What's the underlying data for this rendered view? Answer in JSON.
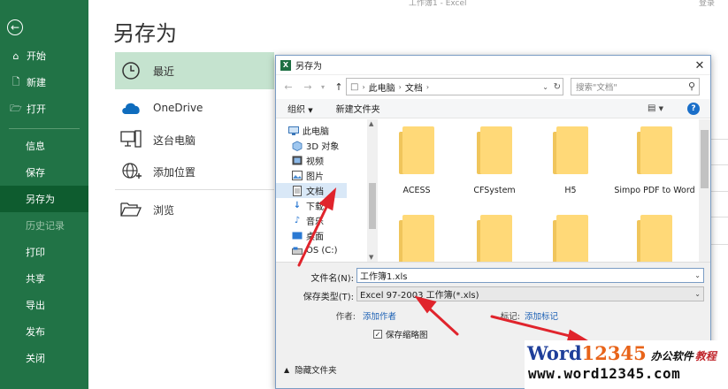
{
  "window": {
    "title": "工作簿1 - Excel",
    "signin": "登录"
  },
  "sidebar": {
    "items": [
      {
        "label": "开始",
        "icon": "home-icon"
      },
      {
        "label": "新建",
        "icon": "new-file-icon"
      },
      {
        "label": "打开",
        "icon": "open-folder-icon"
      },
      {
        "label": "信息"
      },
      {
        "label": "保存"
      },
      {
        "label": "另存为"
      },
      {
        "label": "历史记录"
      },
      {
        "label": "打印"
      },
      {
        "label": "共享"
      },
      {
        "label": "导出"
      },
      {
        "label": "发布"
      },
      {
        "label": "关闭"
      }
    ]
  },
  "main": {
    "title": "另存为",
    "places": [
      {
        "label": "最近",
        "icon": "clock-icon"
      },
      {
        "label": "OneDrive",
        "icon": "cloud-icon"
      },
      {
        "label": "这台电脑",
        "icon": "computer-icon"
      },
      {
        "label": "添加位置",
        "icon": "globe-add-icon"
      },
      {
        "label": "浏览",
        "icon": "folder-open-icon"
      }
    ]
  },
  "dialog": {
    "title": "另存为",
    "address": {
      "crumbs": [
        "此电脑",
        "文档"
      ]
    },
    "search_placeholder": "搜索\"文档\"",
    "toolbar": {
      "organize": "组织",
      "new_folder": "新建文件夹"
    },
    "nav": [
      {
        "label": "此电脑",
        "icon": "pc-icon"
      },
      {
        "label": "3D 对象",
        "icon": "cube-icon"
      },
      {
        "label": "视频",
        "icon": "video-icon"
      },
      {
        "label": "图片",
        "icon": "picture-icon"
      },
      {
        "label": "文档",
        "icon": "document-icon"
      },
      {
        "label": "下载",
        "icon": "download-icon"
      },
      {
        "label": "音乐",
        "icon": "music-icon"
      },
      {
        "label": "桌面",
        "icon": "desktop-icon"
      },
      {
        "label": "OS (C:)",
        "icon": "drive-icon"
      }
    ],
    "folders": [
      {
        "name": "ACESS"
      },
      {
        "name": "CFSystem"
      },
      {
        "name": "H5"
      },
      {
        "name": "Simpo PDF to Word"
      },
      {
        "name": ""
      },
      {
        "name": ""
      },
      {
        "name": ""
      },
      {
        "name": ""
      }
    ],
    "form": {
      "filename_label": "文件名(N):",
      "filename_value": "工作簿1.xls",
      "filetype_label": "保存类型(T):",
      "filetype_value": "Excel 97-2003 工作簿(*.xls)",
      "author_label": "作者:",
      "author_link": "添加作者",
      "tags_label": "标记:",
      "tags_link": "添加标记",
      "thumbnail_label": "保存缩略图",
      "thumbnail_checked": true,
      "hide_folders": "隐藏文件夹"
    }
  },
  "watermark": {
    "word": "Word",
    "num": "12345",
    "cn": "办公软件",
    "cn2": "教程",
    "url": "www.word12345.com"
  },
  "colors": {
    "sidebar": "#217346",
    "sidebar_active": "#0e5c2f",
    "place_selected": "#c5e3cf",
    "annotation_arrow": "#e0242c"
  }
}
